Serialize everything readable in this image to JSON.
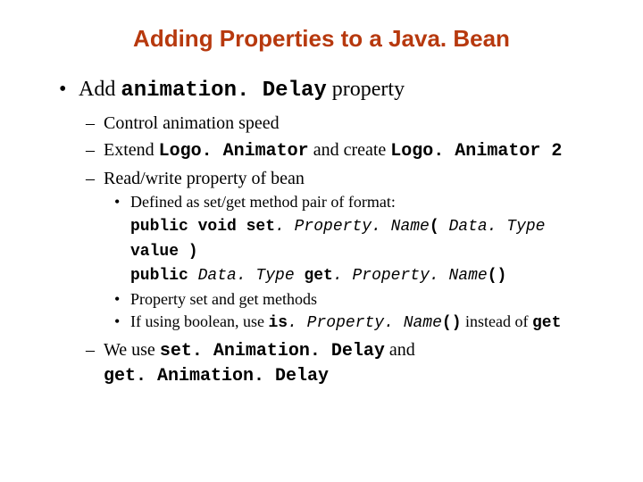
{
  "title": "Adding Properties to a Java. Bean",
  "bullet1": {
    "pre": "Add ",
    "code": "animation. Delay",
    "post": " property"
  },
  "sub1": "Control animation speed",
  "sub2": {
    "a": "Extend ",
    "b": "Logo. Animator",
    "c": " and create ",
    "d": "Logo. Animator 2"
  },
  "sub3": "Read/write property of bean",
  "s3b1": "Defined as set/get method pair of format:",
  "sig1": {
    "a": "public void set",
    "b": ". Property. Name",
    "c": "( ",
    "d": "Data. Type",
    "e": " value )"
  },
  "sig2": {
    "a": "public ",
    "b": "Data. Type",
    "c": " get",
    "d": ". Property. Name",
    "e": "()"
  },
  "s3b2": "Property set and get methods",
  "s3b3": {
    "a": "If using boolean, use ",
    "b": "is",
    "c": ". Property. Name",
    "d": "()",
    "e": " instead of ",
    "f": "get"
  },
  "sub4": {
    "a": "We use ",
    "b": "set. Animation. Delay",
    "c": " and ",
    "d": "get. Animation. Delay"
  }
}
